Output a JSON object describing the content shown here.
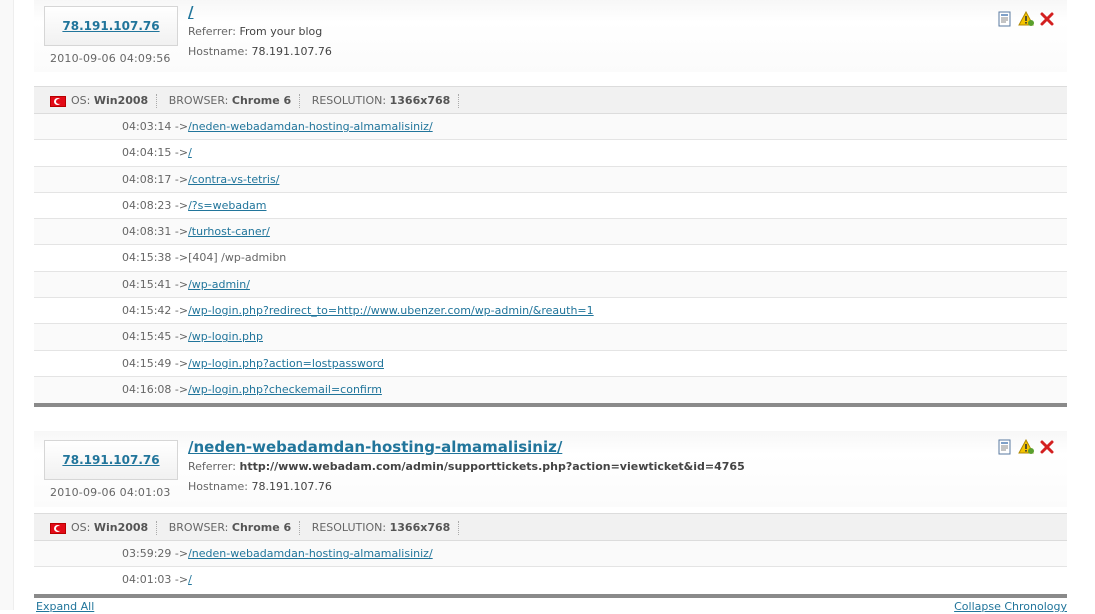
{
  "visits": [
    {
      "ip": "78.191.107.76",
      "date": "2010-09-06 04:09:56",
      "entry_path": "/",
      "referrer_label": "Referrer:",
      "referrer_value": "From your blog",
      "hostname_label": "Hostname:",
      "hostname_value": "78.191.107.76",
      "os_label": "OS:",
      "os_value": "Win2008",
      "browser_label": "BROWSER:",
      "browser_value": "Chrome 6",
      "resolution_label": "RESOLUTION:",
      "resolution_value": "1366x768",
      "hits": [
        {
          "time": "04:03:14",
          "arrow": "->",
          "path": "/neden-webadamdan-hosting-almamalisiniz/",
          "is_link": true
        },
        {
          "time": "04:04:15",
          "arrow": "->",
          "path": "/",
          "is_link": true
        },
        {
          "time": "04:08:17",
          "arrow": "->",
          "path": "/contra-vs-tetris/",
          "is_link": true
        },
        {
          "time": "04:08:23",
          "arrow": "->",
          "path": "/?s=webadam",
          "is_link": true
        },
        {
          "time": "04:08:31",
          "arrow": "->",
          "path": "/turhost-caner/",
          "is_link": true
        },
        {
          "time": "04:15:38",
          "arrow": "->",
          "path": "[404] /wp-admibn",
          "is_link": false
        },
        {
          "time": "04:15:41",
          "arrow": "->",
          "path": "/wp-admin/",
          "is_link": true
        },
        {
          "time": "04:15:42",
          "arrow": "->",
          "path": "/wp-login.php?redirect_to=http://www.ubenzer.com/wp-admin/&reauth=1",
          "is_link": true
        },
        {
          "time": "04:15:45",
          "arrow": "->",
          "path": "/wp-login.php",
          "is_link": true
        },
        {
          "time": "04:15:49",
          "arrow": "->",
          "path": "/wp-login.php?action=lostpassword",
          "is_link": true
        },
        {
          "time": "04:16:08",
          "arrow": "->",
          "path": "/wp-login.php?checkemail=confirm",
          "is_link": true
        }
      ]
    },
    {
      "ip": "78.191.107.76",
      "date": "2010-09-06 04:01:03",
      "entry_path": "/neden-webadamdan-hosting-almamalisiniz/",
      "referrer_label": "Referrer:",
      "referrer_value": "http://www.webadam.com/admin/supporttickets.php?action=viewticket&id=4765",
      "hostname_label": "Hostname:",
      "hostname_value": "78.191.107.76",
      "os_label": "OS:",
      "os_value": "Win2008",
      "browser_label": "BROWSER:",
      "browser_value": "Chrome 6",
      "resolution_label": "RESOLUTION:",
      "resolution_value": "1366x768",
      "hits": [
        {
          "time": "03:59:29",
          "arrow": "->",
          "path": "/neden-webadamdan-hosting-almamalisiniz/",
          "is_link": true
        },
        {
          "time": "04:01:03",
          "arrow": "->",
          "path": "/",
          "is_link": true
        }
      ]
    }
  ],
  "footer": {
    "expand_all": "Expand All",
    "collapse": "Collapse Chronology"
  },
  "icons": {
    "details": "details-icon",
    "spam": "warning-icon",
    "delete": "delete-icon"
  },
  "colors": {
    "link": "#21759b",
    "delete": "#d32020",
    "warning": "#e8b400",
    "separator": "#8a8a8a"
  }
}
